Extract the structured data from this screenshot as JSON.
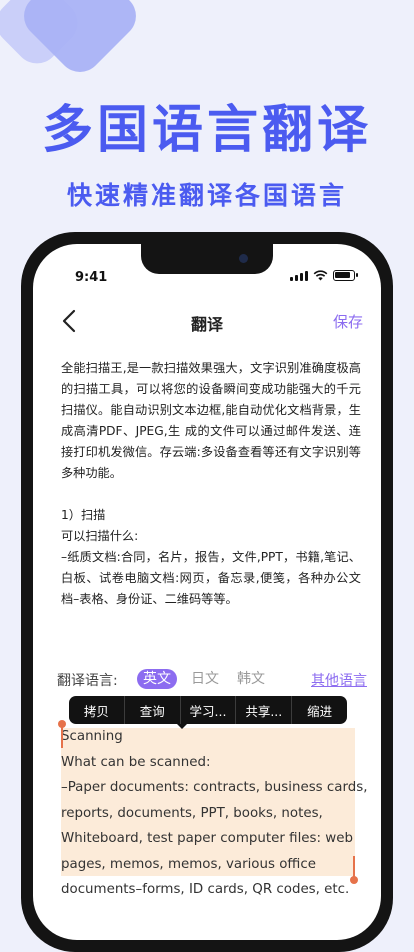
{
  "promo": {
    "headline": "多国语言翻译",
    "subline": "快速精准翻译各国语言"
  },
  "status_bar": {
    "time": "9:41"
  },
  "navbar": {
    "title": "翻译",
    "save_label": "保存",
    "back_icon": "chevron-left-icon"
  },
  "document": {
    "intro": "全能扫描王,是一款扫描效果强大，文字识别准确度极高的扫描工具，可以将您的设备瞬间变成功能强大的千元扫描仪。能自动识别文本边框,能自动优化文档背景，生成高清PDF、JPEG,生 成的文件可以通过邮件发送、连接打印机发微信。存云端:多设备查看等还有文字识别等多种功能。",
    "section_title": "1）扫描",
    "question": "可以扫描什么:",
    "details": "–纸质文档:合同，名片，报告，文件,PPT，书籍,笔记、白板、试卷电脑文档:网页，备忘录,便笺，各种办公文档–表格、身份证、二维码等等。"
  },
  "language_bar": {
    "label": "翻译语言:",
    "options": [
      "英文",
      "日文",
      "韩文"
    ],
    "selected": "英文",
    "other_label": "其他语言"
  },
  "context_menu": {
    "items": [
      "拷贝",
      "查询",
      "学习...",
      "共享...",
      "缩进"
    ]
  },
  "translation": {
    "lines": [
      "Scanning",
      "What can be scanned:",
      "–Paper documents: contracts, business cards,",
      "reports, documents, PPT, books, notes,",
      "Whiteboard, test paper computer files: web",
      " pages, memos, memos, various office",
      "documents–forms, ID cards, QR codes, etc."
    ]
  },
  "colors": {
    "accent": "#4b5bf0",
    "purple": "#8c6cf0",
    "selection": "#fcebd9",
    "handle": "#e6724a"
  }
}
